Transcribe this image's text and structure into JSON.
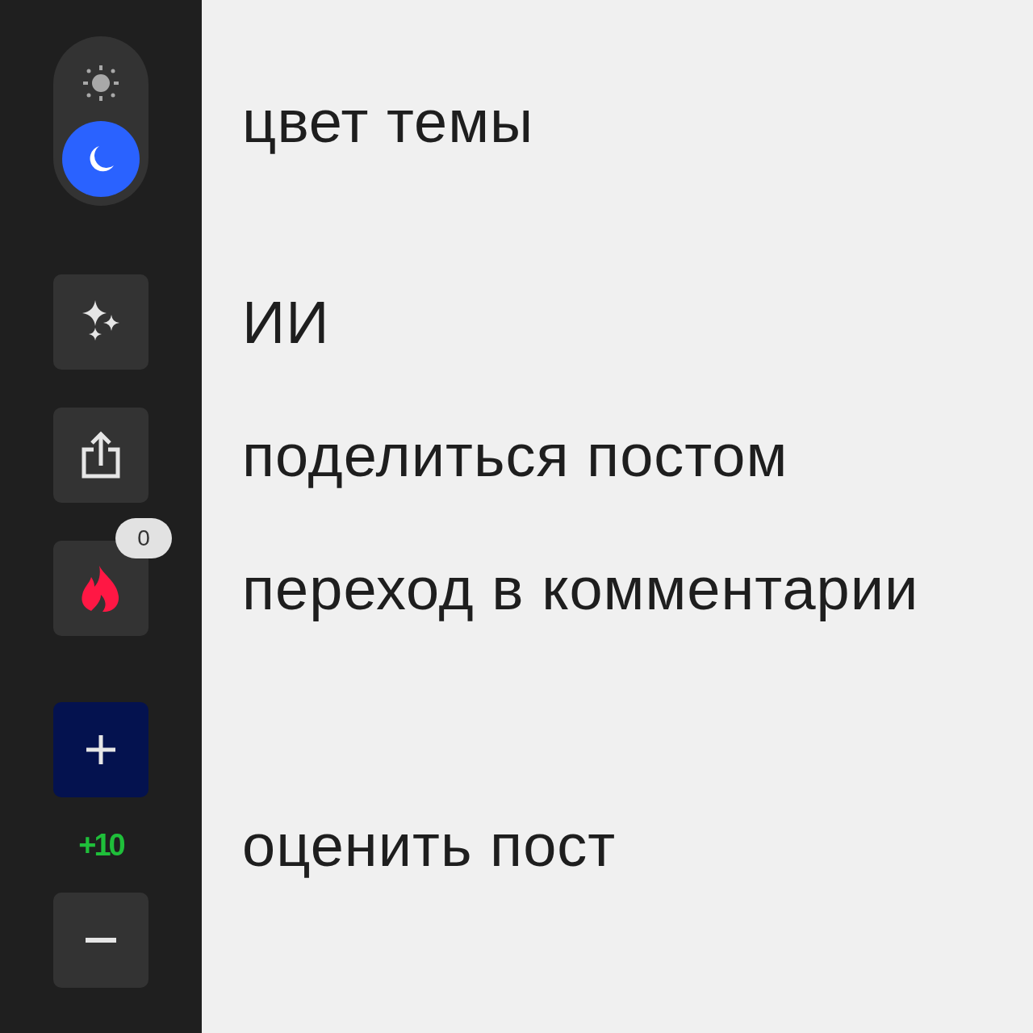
{
  "theme_toggle": {
    "label": "цвет темы",
    "options": [
      {
        "kind": "light",
        "selected": false
      },
      {
        "kind": "dark",
        "selected": true
      }
    ]
  },
  "actions": [
    {
      "kind": "ai",
      "label": "ИИ"
    },
    {
      "kind": "share",
      "label": "поделиться постом"
    },
    {
      "kind": "comments",
      "label": "переход в комментарии",
      "badge": "0"
    }
  ],
  "rating": {
    "upvote_active": true,
    "score": "+10",
    "label": "оценить пост"
  }
}
